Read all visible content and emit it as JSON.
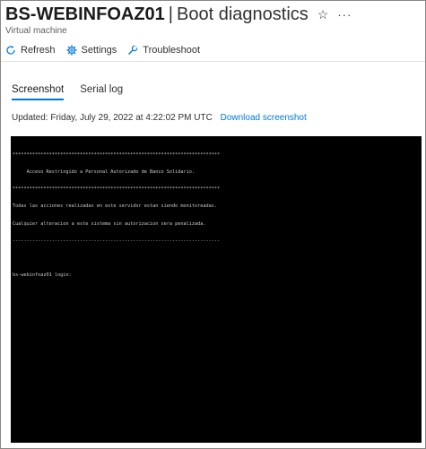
{
  "header": {
    "resource_name": "BS-WEBINFOAZ01",
    "separator": "|",
    "page_name": "Boot diagnostics",
    "subtitle": "Virtual machine"
  },
  "toolbar": {
    "refresh_label": "Refresh",
    "settings_label": "Settings",
    "troubleshoot_label": "Troubleshoot"
  },
  "tabs": [
    {
      "label": "Screenshot",
      "active": true
    },
    {
      "label": "Serial log",
      "active": false
    }
  ],
  "status": {
    "updated_text": "Updated: Friday, July 29, 2022 at 4:22:02 PM UTC",
    "download_label": "Download screenshot"
  },
  "console": {
    "lines": [
      "**************************************************************************",
      "     Acceso Restringido a Personal Autorizado de Banco Solidario.",
      "**************************************************************************",
      "Todas las acciones realizadas en este servidor estan siendo monitoreadas.",
      "Cualquier alteracion a este sistema sin autorizacion sera penalizada.",
      "--------------------------------------------------------------------------",
      "",
      "bs-webinfoaz01 login:"
    ]
  },
  "colors": {
    "accent": "#0078d4",
    "console_bg": "#000000",
    "console_text": "#c8c8c8"
  },
  "icons": {
    "star": "star-icon",
    "more": "more-icon",
    "refresh": "refresh-icon",
    "settings": "gear-icon",
    "troubleshoot": "wrench-icon"
  }
}
